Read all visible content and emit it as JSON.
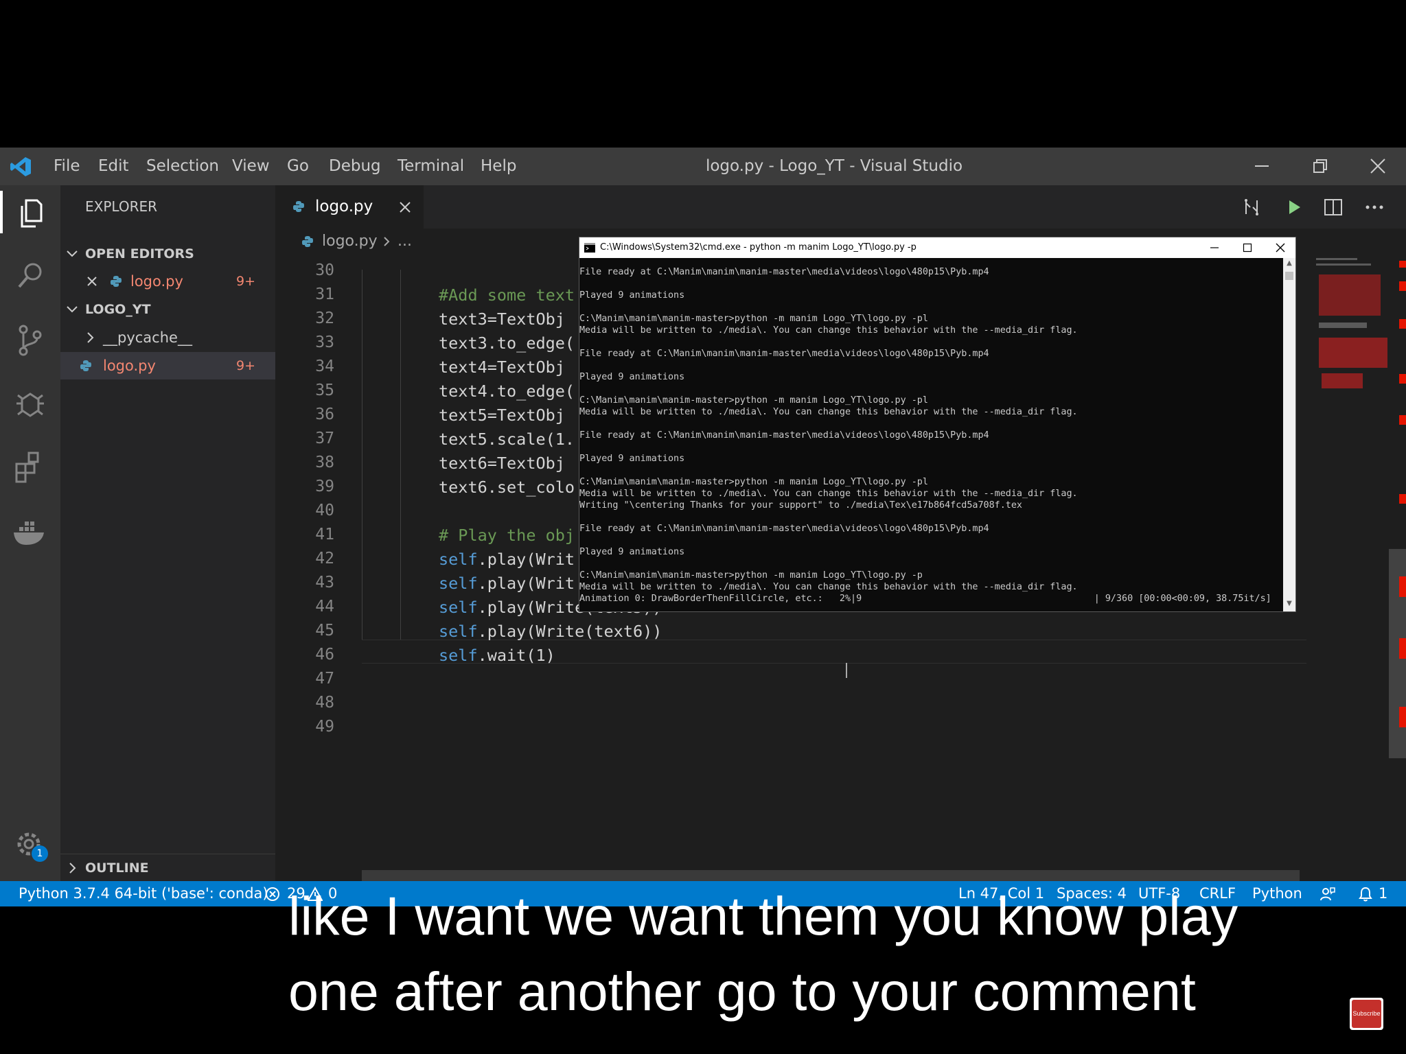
{
  "window": {
    "title": "logo.py - Logo_YT - Visual Studio Code",
    "menu": [
      "File",
      "Edit",
      "Selection",
      "View",
      "Go",
      "Debug",
      "Terminal",
      "Help"
    ]
  },
  "sidebar": {
    "title": "EXPLORER",
    "open_editors_label": "OPEN EDITORS",
    "open_editor_file": "logo.py",
    "open_editor_badge": "9+",
    "folder_label": "LOGO_YT",
    "tree": [
      {
        "label": "__pycache__",
        "badge": ""
      },
      {
        "label": "logo.py",
        "badge": "9+"
      }
    ],
    "outline_label": "OUTLINE",
    "settings_badge": "1"
  },
  "editor": {
    "tab_label": "logo.py",
    "breadcrumb_file": "logo.py",
    "breadcrumb_more": "...",
    "line_numbers": [
      "30",
      "31",
      "32",
      "33",
      "34",
      "35",
      "36",
      "37",
      "38",
      "39",
      "40",
      "41",
      "42",
      "43",
      "44",
      "45",
      "46",
      "47",
      "48",
      "49"
    ],
    "code": {
      "l31": "#Add some text",
      "l32": "text3=TextObj",
      "l33": "text3.to_edge(",
      "l34": "text4=TextObj",
      "l35": "text4.to_edge(",
      "l36": "text5=TextObj",
      "l37": "text5.scale(1.",
      "l38": "text6=TextObj",
      "l39": "text6.set_colo",
      "l41": "# Play the obj",
      "l42_self": "self",
      "l42_rest": ".play(Writ",
      "l43_self": "self",
      "l43_rest": ".play(Writ",
      "l44_self": "self",
      "l44_rest": ".play(Write(text5))",
      "l45_self": "self",
      "l45_rest": ".play(Write(text6))",
      "l46_self": "self",
      "l46_rest": ".wait(1)"
    }
  },
  "cmd": {
    "title": "C:\\Windows\\System32\\cmd.exe - python  -m manim Logo_YT\\logo.py -p",
    "lines": [
      "File ready at C:\\Manim\\manim\\manim-master\\media\\videos\\logo\\480p15\\Pyb.mp4",
      "",
      "Played 9 animations",
      "",
      "C:\\Manim\\manim\\manim-master>python -m manim Logo_YT\\logo.py -pl",
      "Media will be written to ./media\\. You can change this behavior with the --media_dir flag.",
      "",
      "File ready at C:\\Manim\\manim\\manim-master\\media\\videos\\logo\\480p15\\Pyb.mp4",
      "",
      "Played 9 animations",
      "",
      "C:\\Manim\\manim\\manim-master>python -m manim Logo_YT\\logo.py -pl",
      "Media will be written to ./media\\. You can change this behavior with the --media_dir flag.",
      "",
      "File ready at C:\\Manim\\manim\\manim-master\\media\\videos\\logo\\480p15\\Pyb.mp4",
      "",
      "Played 9 animations",
      "",
      "C:\\Manim\\manim\\manim-master>python -m manim Logo_YT\\logo.py -pl",
      "Media will be written to ./media\\. You can change this behavior with the --media_dir flag.",
      "Writing \"\\centering Thanks for your support\" to ./media\\Tex\\e17b864fcd5a708f.tex",
      "",
      "File ready at C:\\Manim\\manim\\manim-master\\media\\videos\\logo\\480p15\\Pyb.mp4",
      "",
      "Played 9 animations",
      "",
      "C:\\Manim\\manim\\manim-master>python -m manim Logo_YT\\logo.py -p",
      "Media will be written to ./media\\. You can change this behavior with the --media_dir flag.",
      "Animation 0: DrawBorderThenFillCircle, etc.:   2%|9                                          | 9/360 [00:00<00:09, 38.75it/s]"
    ]
  },
  "status": {
    "interpreter": "Python 3.7.4 64-bit ('base': conda)",
    "errors": "29",
    "warnings": "0",
    "position": "Ln 47, Col 1",
    "spaces": "Spaces: 4",
    "encoding": "UTF-8",
    "eol": "CRLF",
    "language": "Python",
    "notifications": "1"
  },
  "subtitles": {
    "line1": "like I want we want them you know play",
    "line2": "one after another go to your comment"
  },
  "subscribe_label": "Subscribe",
  "colors": {
    "accent": "#007acc",
    "error_file": "#f48771",
    "keyword_self": "#569cd6",
    "comment": "#6a9955"
  }
}
